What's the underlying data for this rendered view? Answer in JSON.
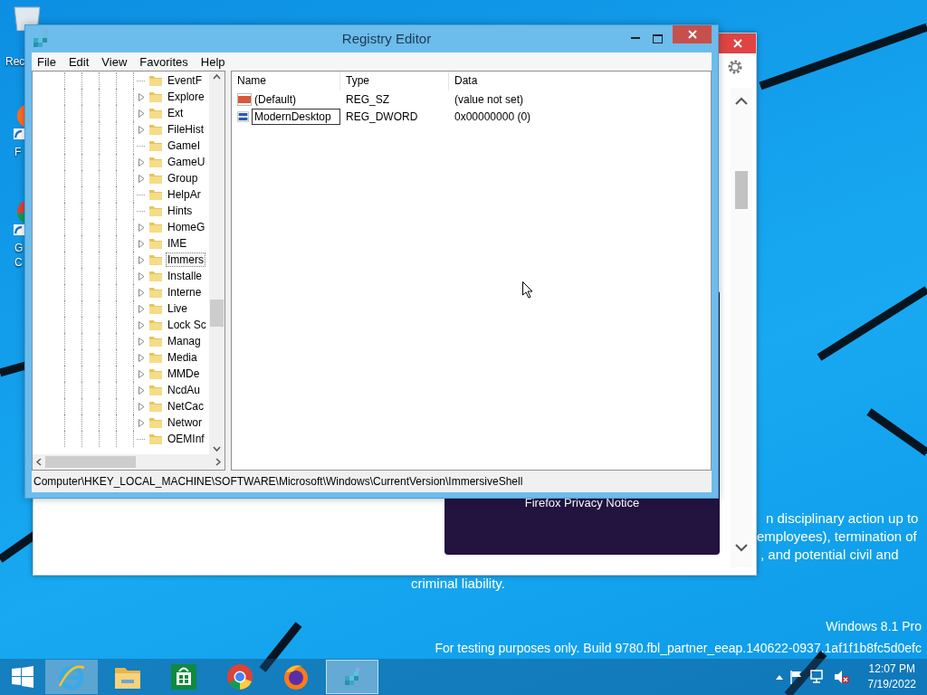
{
  "desktop": {
    "icons": [
      {
        "kind": "bin",
        "label": "Rec"
      },
      {
        "kind": "firefox",
        "label": "F"
      },
      {
        "kind": "chrome",
        "label": "G C"
      }
    ],
    "background_text": [
      "n disciplinary action up to",
      "employees), termination of",
      ", and potential civil and",
      "criminal liability."
    ],
    "os_edition": "Windows 8.1 Pro",
    "build_notice": "For testing purposes only. Build 9780.fbl_partner_eeap.140622-0937.1af1f1b8fc5d0efc"
  },
  "browser_window": {
    "card_title": "Firefox Privacy Notice"
  },
  "registry_editor": {
    "title": "Registry Editor",
    "menu": [
      "File",
      "Edit",
      "View",
      "Favorites",
      "Help"
    ],
    "tree": [
      {
        "name": "EventF",
        "expandable": false,
        "selected": false
      },
      {
        "name": "Explore",
        "expandable": true,
        "selected": false
      },
      {
        "name": "Ext",
        "expandable": true,
        "selected": false
      },
      {
        "name": "FileHist",
        "expandable": true,
        "selected": false
      },
      {
        "name": "GameI",
        "expandable": false,
        "selected": false
      },
      {
        "name": "GameU",
        "expandable": true,
        "selected": false
      },
      {
        "name": "Group",
        "expandable": true,
        "selected": false
      },
      {
        "name": "HelpAr",
        "expandable": false,
        "selected": false
      },
      {
        "name": "Hints",
        "expandable": false,
        "selected": false
      },
      {
        "name": "HomeG",
        "expandable": true,
        "selected": false
      },
      {
        "name": "IME",
        "expandable": true,
        "selected": false
      },
      {
        "name": "Immers",
        "expandable": true,
        "selected": true
      },
      {
        "name": "Installe",
        "expandable": true,
        "selected": false
      },
      {
        "name": "Interne",
        "expandable": true,
        "selected": false
      },
      {
        "name": "Live",
        "expandable": true,
        "selected": false
      },
      {
        "name": "Lock Sc",
        "expandable": true,
        "selected": false
      },
      {
        "name": "Manag",
        "expandable": true,
        "selected": false
      },
      {
        "name": "Media",
        "expandable": true,
        "selected": false
      },
      {
        "name": "MMDe",
        "expandable": true,
        "selected": false
      },
      {
        "name": "NcdAu",
        "expandable": true,
        "selected": false
      },
      {
        "name": "NetCac",
        "expandable": true,
        "selected": false
      },
      {
        "name": "Networ",
        "expandable": true,
        "selected": false
      },
      {
        "name": "OEMInf",
        "expandable": false,
        "selected": false
      }
    ],
    "columns": [
      "Name",
      "Type",
      "Data"
    ],
    "values": [
      {
        "kind": "string",
        "name": "(Default)",
        "type": "REG_SZ",
        "data": "(value not set)",
        "editing": false
      },
      {
        "kind": "binary",
        "name": "ModernDesktop",
        "type": "REG_DWORD",
        "data": "0x00000000 (0)",
        "editing": true
      }
    ],
    "status": "Computer\\HKEY_LOCAL_MACHINE\\SOFTWARE\\Microsoft\\Windows\\CurrentVersion\\ImmersiveShell"
  },
  "taskbar": {
    "apps": [
      {
        "kind": "ie",
        "hovered": true,
        "active": false
      },
      {
        "kind": "explorer",
        "hovered": false,
        "active": false
      },
      {
        "kind": "store",
        "hovered": false,
        "active": false
      },
      {
        "kind": "chrome",
        "hovered": false,
        "active": false
      },
      {
        "kind": "firefox",
        "hovered": false,
        "active": false
      },
      {
        "kind": "regedit",
        "hovered": false,
        "active": true
      }
    ],
    "time": "12:07 PM",
    "date": "7/19/2022"
  }
}
